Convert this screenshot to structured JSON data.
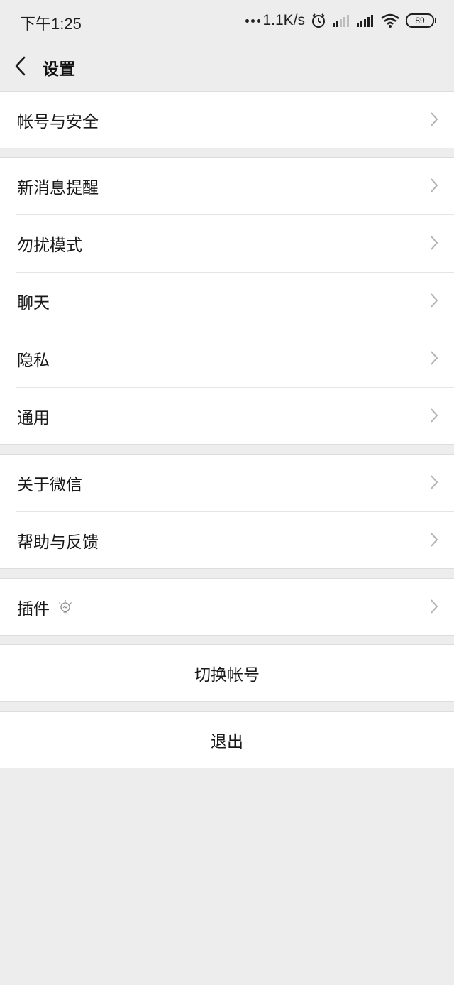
{
  "status_bar": {
    "time": "下午1:25",
    "net_speed": "1.1K/s",
    "battery": "89"
  },
  "nav": {
    "title": "设置"
  },
  "groups": [
    {
      "items": [
        {
          "label": "帐号与安全"
        }
      ]
    },
    {
      "items": [
        {
          "label": "新消息提醒"
        },
        {
          "label": "勿扰模式"
        },
        {
          "label": "聊天"
        },
        {
          "label": "隐私"
        },
        {
          "label": "通用"
        }
      ]
    },
    {
      "items": [
        {
          "label": "关于微信"
        },
        {
          "label": "帮助与反馈"
        }
      ]
    },
    {
      "items": [
        {
          "label": "插件",
          "icon": "lightbulb-icon"
        }
      ]
    }
  ],
  "actions": {
    "switch_account": "切换帐号",
    "logout": "退出"
  },
  "colors": {
    "background": "#ededed",
    "cell_background": "#ffffff",
    "text": "#191919",
    "chevron": "#b2b2b2"
  }
}
